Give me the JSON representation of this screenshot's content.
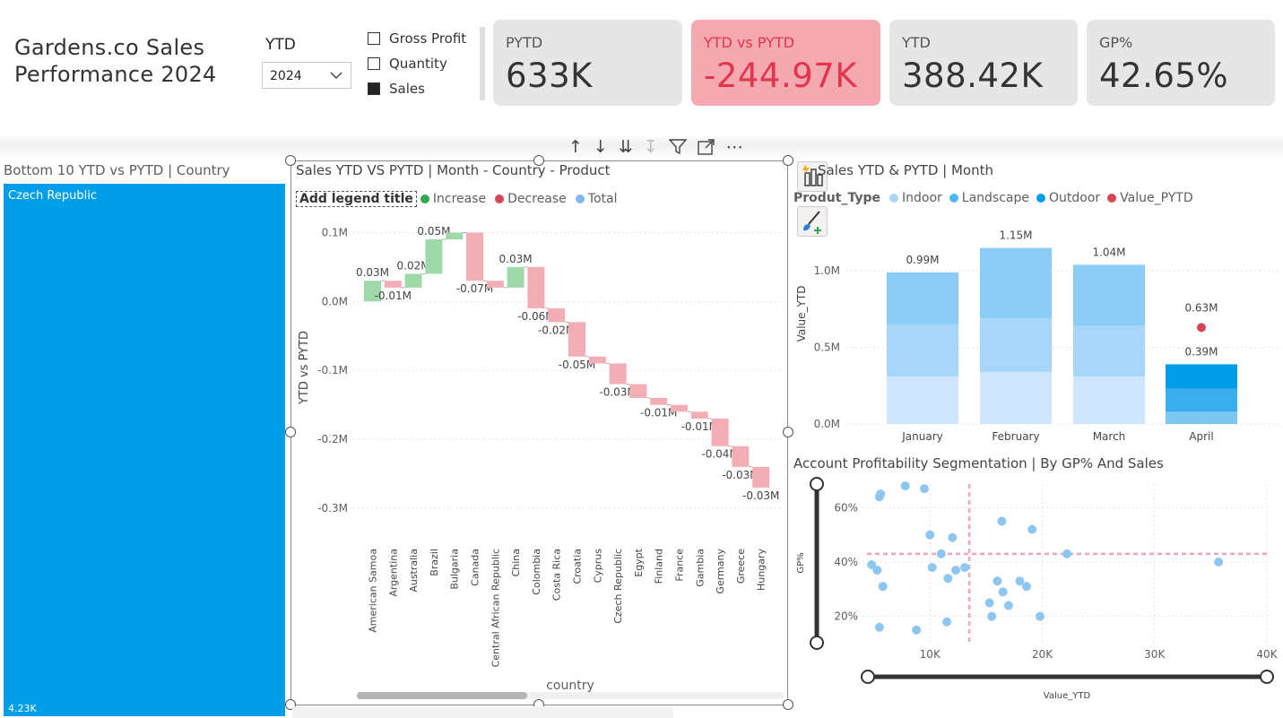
{
  "report": {
    "title_line1": "Gardens.co Sales",
    "title_line2": "Performance 2024"
  },
  "filters": {
    "ytd_label": "YTD",
    "year_value": "2024",
    "measure_options": [
      {
        "label": "Gross Profit",
        "checked": false
      },
      {
        "label": "Quantity",
        "checked": false
      },
      {
        "label": "Sales",
        "checked": true
      }
    ]
  },
  "kpis": [
    {
      "label": "PYTD",
      "value": "633K",
      "highlight": false
    },
    {
      "label": "YTD vs PYTD",
      "value": "-244.97K",
      "highlight": true
    },
    {
      "label": "YTD",
      "value": "388.42K",
      "highlight": false
    },
    {
      "label": "GP%",
      "value": "42.65%",
      "highlight": false
    }
  ],
  "treemap": {
    "title": "Bottom 10 YTD vs PYTD | Country",
    "tile_label": "Czech Republic",
    "tile_value": "4.23K",
    "color": "#009ee8"
  },
  "colors": {
    "increase": "#2fa84f",
    "decrease": "#d64554",
    "total": "#7fb8ef",
    "accent": "#009ee8"
  },
  "chart_data": [
    {
      "type": "bar",
      "subtype": "waterfall",
      "title": "Sales YTD VS PYTD | Month - Country - Product",
      "legend_title": "Add legend title",
      "legend": [
        "Increase",
        "Decrease",
        "Total"
      ],
      "xlabel": "country",
      "ylabel": "YTD vs PYTD",
      "ylim": [
        -0.33,
        0.12
      ],
      "yticks": [
        "0.1M",
        "0.0M",
        "-0.1M",
        "-0.2M",
        "-0.3M"
      ],
      "categories": [
        "American Samoa",
        "Argentina",
        "Australia",
        "Brazil",
        "Bulgaria",
        "Canada",
        "Central African Republic",
        "China",
        "Colombia",
        "Costa Rica",
        "Croatia",
        "Cyprus",
        "Czech Republic",
        "Egypt",
        "Finland",
        "France",
        "Gambia",
        "Germany",
        "Greece",
        "Hungary"
      ],
      "values": [
        0.03,
        -0.01,
        0.02,
        0.05,
        0.01,
        -0.07,
        -0.01,
        0.03,
        -0.06,
        -0.02,
        -0.05,
        -0.01,
        -0.03,
        -0.02,
        -0.01,
        -0.01,
        -0.01,
        -0.04,
        -0.03,
        -0.03
      ],
      "data_labels": [
        "0.03M",
        "-0.01M",
        "0.02M",
        "0.05M",
        "",
        "-0.07M",
        "",
        "0.03M",
        "-0.06M",
        "-0.02M",
        "-0.05M",
        "",
        "-0.03M",
        "",
        "-0.01M",
        "",
        "-0.01M",
        "-0.04M",
        "-0.03M",
        "-0.03M"
      ]
    },
    {
      "type": "bar",
      "subtype": "stacked",
      "title": "Sales YTD & PYTD | Month",
      "legend_title": "Produt_Type",
      "categories": [
        "January",
        "February",
        "March",
        "April"
      ],
      "series": [
        {
          "name": "Indoor",
          "values": [
            0.31,
            0.34,
            0.31,
            0.08
          ],
          "color": "#cfe5fb"
        },
        {
          "name": "Landscape",
          "values": [
            0.34,
            0.35,
            0.33,
            0.15
          ],
          "color": "#a9d6f8"
        },
        {
          "name": "Outdoor",
          "values": [
            0.34,
            0.46,
            0.4,
            0.16
          ],
          "color": "#8ccdf6"
        }
      ],
      "april_colors": [
        "#7cc6f2",
        "#39adee",
        "#009ee8"
      ],
      "totals": [
        0.99,
        1.15,
        1.04,
        0.39
      ],
      "total_labels": [
        "0.99M",
        "1.15M",
        "1.04M",
        "0.39M"
      ],
      "value_pytd": {
        "name": "Value_PYTD",
        "category": "April",
        "value": 0.63,
        "label": "0.63M",
        "color": "#d64554"
      },
      "ylabel": "Value_YTD",
      "ylim": [
        0,
        1.2
      ],
      "yticks": [
        "0.0M",
        "0.5M",
        "1.0M"
      ]
    },
    {
      "type": "scatter",
      "title": "Account Profitability Segmentation | By GP% And Sales",
      "xlabel": "Value_YTD",
      "ylabel": "GP%",
      "xlim": [
        0,
        40
      ],
      "ylim": [
        10,
        70
      ],
      "xticks": [
        "10K",
        "20K",
        "30K",
        "40K"
      ],
      "yticks": [
        "20%",
        "40%",
        "60%"
      ],
      "avg_x": 13.5,
      "avg_y": 43,
      "x": [
        5.5,
        5.6,
        9.5,
        7.8,
        10.0,
        12.0,
        13.1,
        11.6,
        11.0,
        10.2,
        4.8,
        5.3,
        5.8,
        5.5,
        8.8,
        11.5,
        12.3,
        16.0,
        16.5,
        17.0,
        15.5,
        15.3,
        16.4,
        19.1,
        18.6,
        18.0,
        19.8,
        22.2,
        35.7
      ],
      "y": [
        64,
        65,
        67,
        68,
        50,
        49,
        38,
        34,
        43,
        38,
        39,
        37,
        31,
        16,
        15,
        18,
        37,
        33,
        29,
        24,
        20,
        25,
        55,
        52,
        31,
        33,
        20,
        43,
        40
      ]
    }
  ]
}
